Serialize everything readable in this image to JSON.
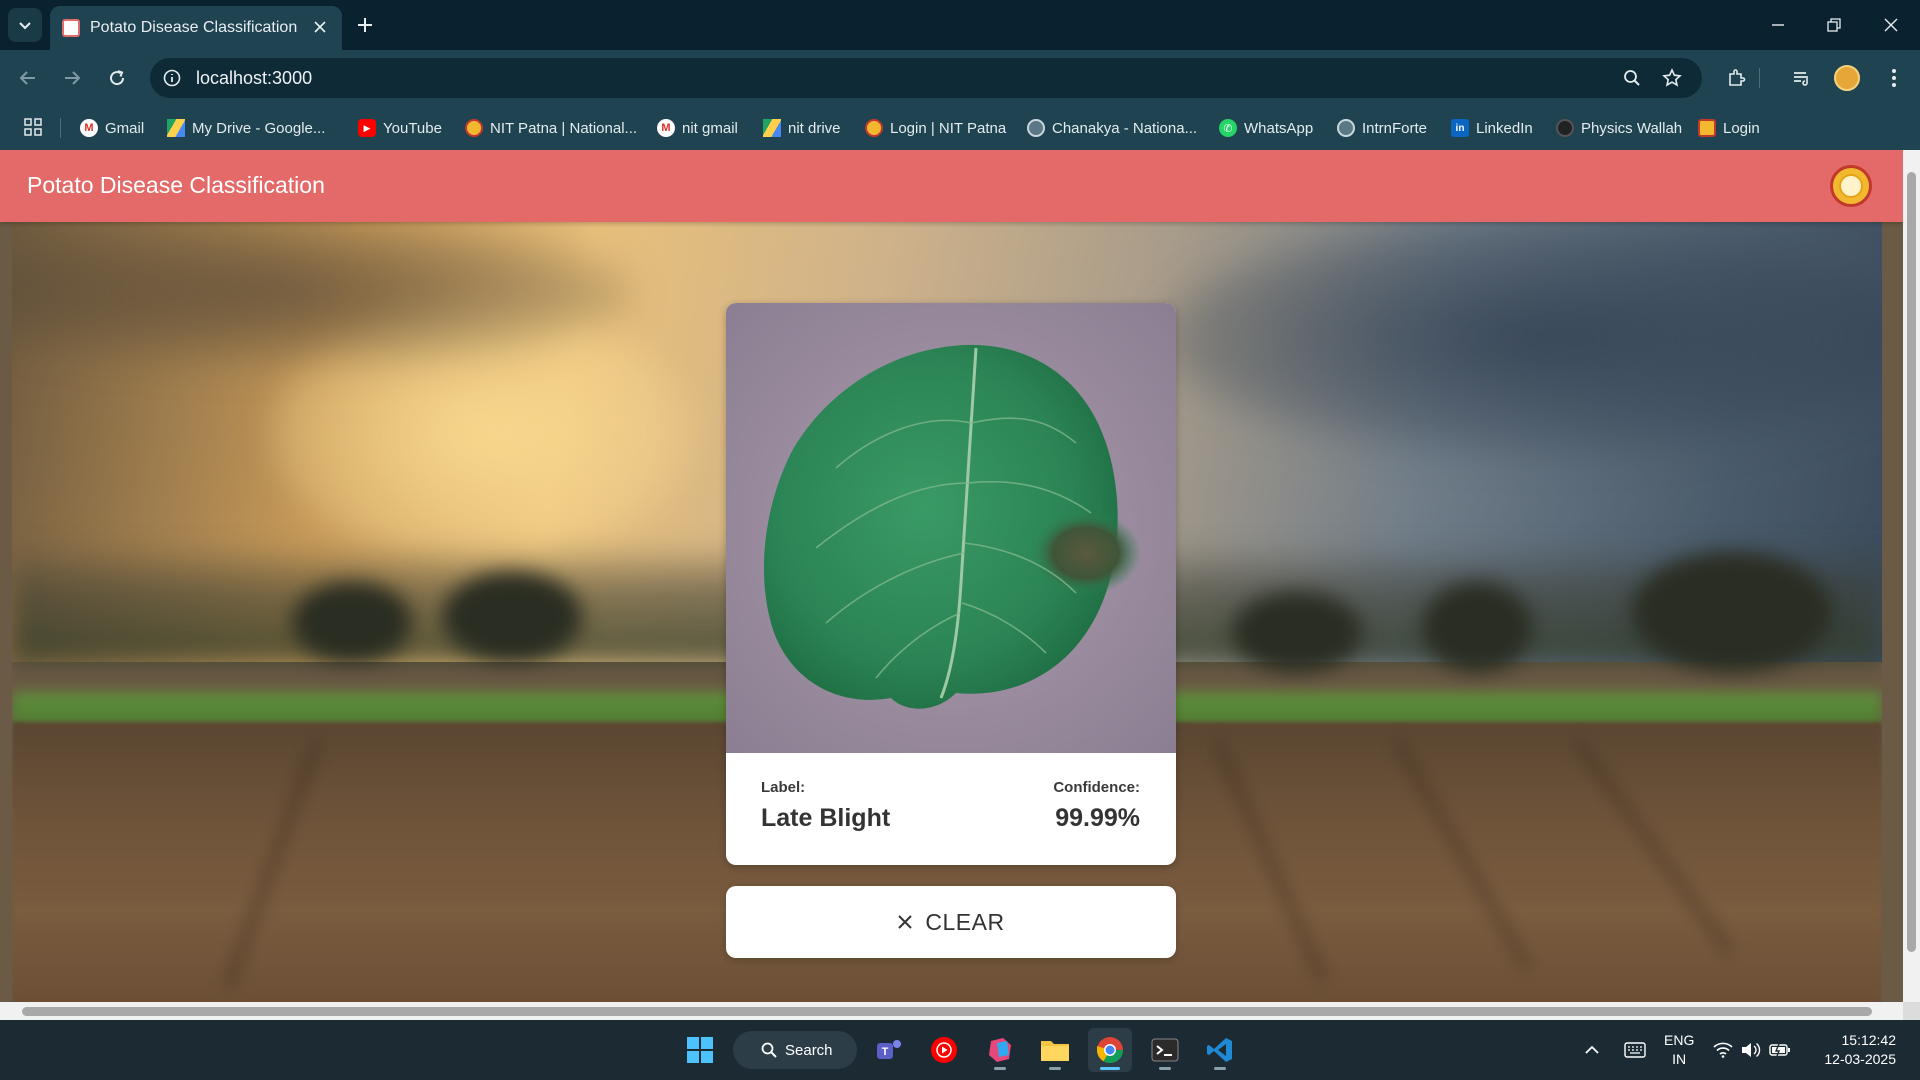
{
  "browser": {
    "tab_title": "Potato Disease Classification",
    "url": "localhost:3000"
  },
  "bookmarks": [
    {
      "label": "Gmail",
      "icon": "gmail-icon"
    },
    {
      "label": "My Drive - Google...",
      "icon": "google-drive-icon"
    },
    {
      "label": "YouTube",
      "icon": "youtube-icon"
    },
    {
      "label": "NIT Patna | National...",
      "icon": "nit-patna-icon"
    },
    {
      "label": "nit gmail",
      "icon": "gmail-icon"
    },
    {
      "label": "nit drive",
      "icon": "google-drive-icon"
    },
    {
      "label": "Login | NIT Patna",
      "icon": "nit-patna-icon"
    },
    {
      "label": "Chanakya - Nationa...",
      "icon": "globe-icon"
    },
    {
      "label": "WhatsApp",
      "icon": "whatsapp-icon"
    },
    {
      "label": "IntrnForte",
      "icon": "globe-icon"
    },
    {
      "label": "LinkedIn",
      "icon": "linkedin-icon"
    },
    {
      "label": "Physics Wallah",
      "icon": "physics-wallah-icon"
    },
    {
      "label": "Login",
      "icon": "nit-patna-icon"
    }
  ],
  "app": {
    "title": "Potato Disease Classification",
    "result": {
      "label_caption": "Label:",
      "label_value": "Late Blight",
      "confidence_caption": "Confidence:",
      "confidence_value": "99.99%"
    },
    "clear_label": "CLEAR"
  },
  "taskbar": {
    "search_label": "Search",
    "language": "ENG",
    "region": "IN",
    "time": "15:12:42",
    "date": "12-03-2025"
  },
  "colors": {
    "app_header": "#e46a6a",
    "browser_frame": "#1f4350",
    "tabstrip": "#0a2230",
    "taskbar": "#1c2a33",
    "leaf": "#2f8a5a"
  }
}
